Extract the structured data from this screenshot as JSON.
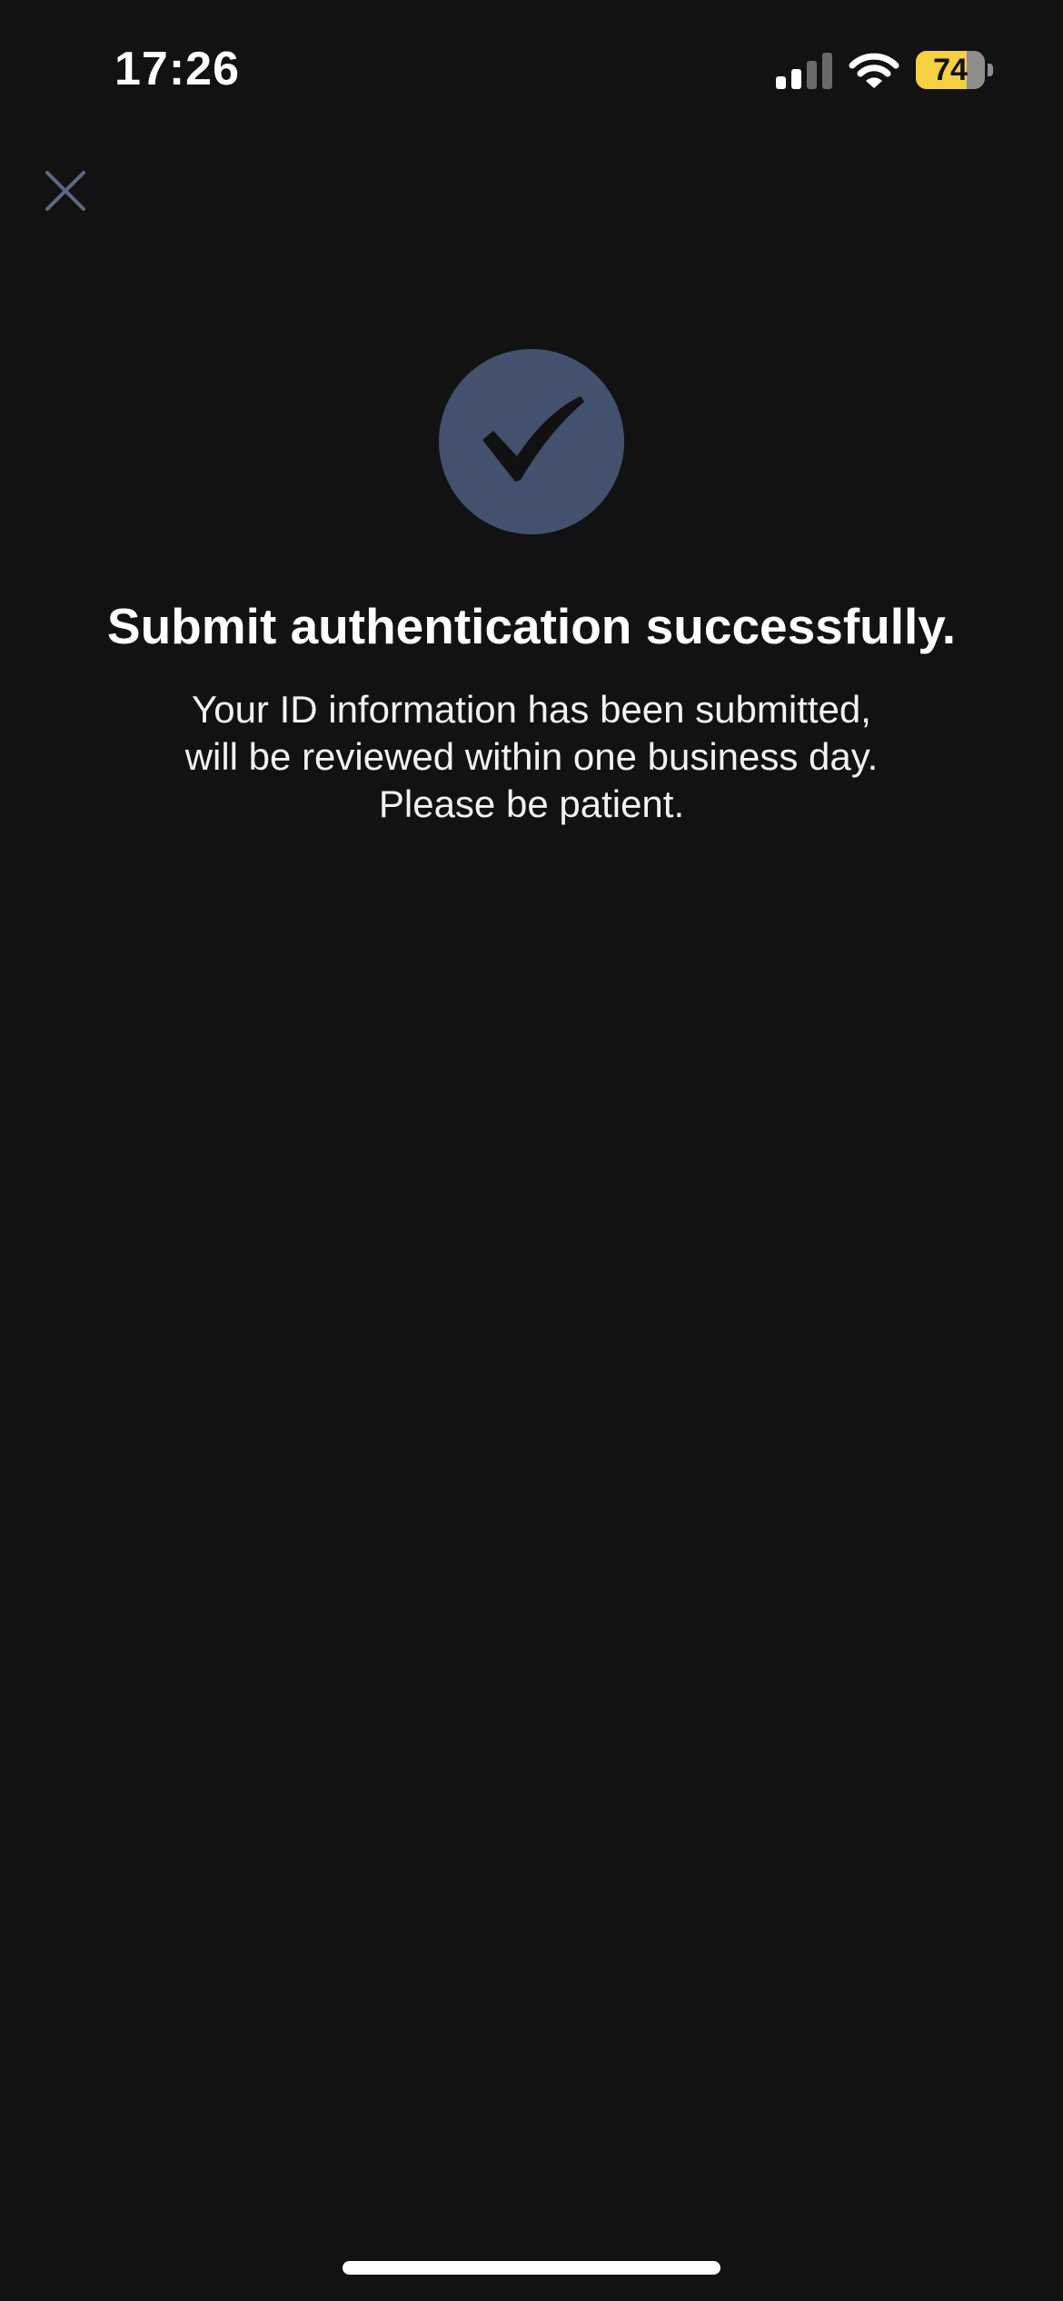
{
  "status_bar": {
    "time": "17:26",
    "signal_icon": "cellular-signal-icon",
    "signal_bars_active": 2,
    "signal_bars_total": 4,
    "wifi_icon": "wifi-icon",
    "battery_icon": "battery-icon",
    "battery_level": "74",
    "battery_fraction": 0.74,
    "battery_color": "#f6cf42"
  },
  "header": {
    "close_icon": "close-icon"
  },
  "success": {
    "icon": "checkmark-icon",
    "badge_color": "#43506e",
    "title": "Submit authentication successfully.",
    "message_lines": [
      "Your ID information has been submitted,",
      "will be reviewed within one business day.",
      "Please be patient."
    ]
  },
  "colors": {
    "background": "#121212",
    "accent": "#43506e",
    "close_icon": "#5a6a85"
  }
}
